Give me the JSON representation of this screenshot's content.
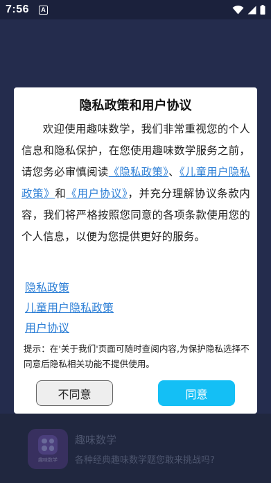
{
  "status_bar": {
    "time": "7:56",
    "notification_glyph": "A",
    "icons": [
      "wifi-icon",
      "signal-icon",
      "battery-icon"
    ]
  },
  "dialog": {
    "title": "隐私政策和用户协议",
    "body": {
      "part1": "欢迎使用趣味数学，我们非常重视您的个人信息和隐私保护，在您使用趣味数学服务之前，请您务必审慎阅读",
      "link_privacy": "《隐私政策》",
      "sep1": "、",
      "link_children": "《儿童用户隐私政策》",
      "sep2": "和",
      "link_user": "《用户协议》",
      "part2": "，并充分理解协议条款内容，我们将严格按照您同意的各项条款使用您的个人信息，以便为您提供更好的服务。"
    },
    "links": [
      "隐私政策",
      "儿童用户隐私政策",
      "用户协议"
    ],
    "tip": "提示：在'关于我们'页面可随时查阅内容,为保护隐私选择不同意后隐私相关功能不提供使用。",
    "buttons": {
      "disagree": "不同意",
      "agree": "同意"
    }
  },
  "background_app": {
    "name": "趣味数学",
    "description": "各种经典趣味数学题您敢来挑战吗?",
    "icon_label": "趣味数学"
  },
  "colors": {
    "link": "#2d7fd6",
    "agree_button": "#14bff5",
    "background": "#242c4d"
  }
}
